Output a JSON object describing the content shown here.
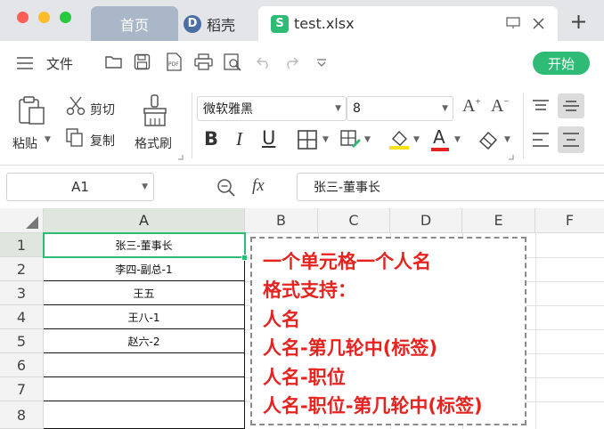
{
  "titlebar": {
    "tabs": [
      {
        "label": "首页"
      },
      {
        "label": "稻壳"
      },
      {
        "label": "test.xlsx"
      }
    ]
  },
  "menubar": {
    "file_label": "文件",
    "start_label": "开始"
  },
  "ribbon": {
    "paste_label": "粘贴",
    "cut_label": "剪切",
    "copy_label": "复制",
    "format_painter_label": "格式刷",
    "font_name": "微软雅黑",
    "font_size": "8"
  },
  "formulabar": {
    "cell_ref": "A1",
    "fx_label": "fx",
    "formula_value": "张三-董事长"
  },
  "sheet": {
    "columns": [
      "A",
      "B",
      "C",
      "D",
      "E",
      "F"
    ],
    "rows": [
      "1",
      "2",
      "3",
      "4",
      "5",
      "6",
      "7",
      "8"
    ],
    "cells_a": [
      "张三-董事长",
      "李四-副总-1",
      "王五",
      "王八-1",
      "赵六-2",
      "",
      "",
      ""
    ],
    "note_lines": [
      "一个单元格一个人名",
      "格式支持：",
      "人名",
      "人名-第几轮中(标签)",
      "人名-职位",
      "人名-职位-第几轮中(标签)"
    ]
  },
  "colors": {
    "accent_green": "#2dbb76",
    "note_red": "#e5231f",
    "tab_active_bg": "#a9b7c9"
  }
}
